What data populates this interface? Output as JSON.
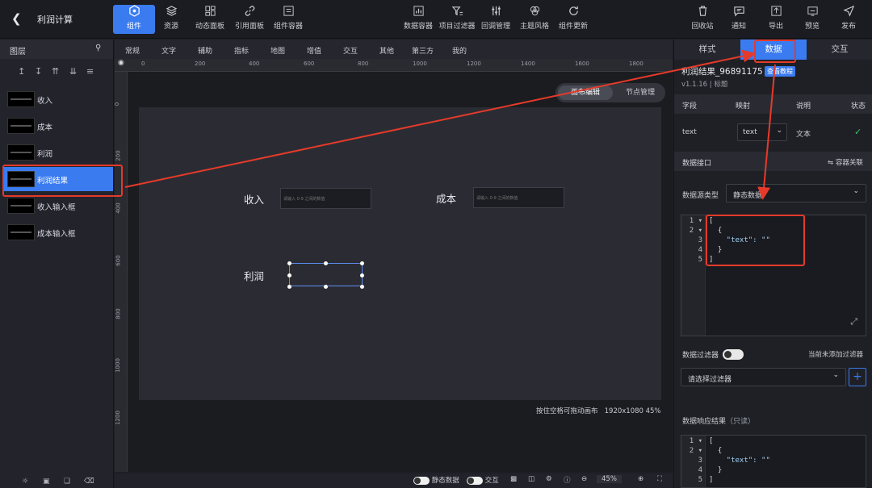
{
  "header": {
    "title": "利润计算",
    "left_tools": [
      "组件",
      "资源",
      "动态面板",
      "引用面板",
      "组件容器"
    ],
    "center_tools": [
      "数据容器",
      "项目过滤器",
      "回调管理",
      "主题风格",
      "组件更新"
    ],
    "right_tools": [
      "回收站",
      "通知",
      "导出",
      "预览",
      "发布"
    ]
  },
  "layers": {
    "title": "图层",
    "items": [
      {
        "name": "收入"
      },
      {
        "name": "成本"
      },
      {
        "name": "利润"
      },
      {
        "name": "利润结果"
      },
      {
        "name": "收入输入框"
      },
      {
        "name": "成本输入框"
      }
    ],
    "selected": "利润结果"
  },
  "component_tabs": [
    "常规",
    "文字",
    "辅助",
    "指标",
    "地图",
    "增值",
    "交互",
    "其他",
    "第三方",
    "我的"
  ],
  "ruler": {
    "h_ticks": [
      "0",
      "200",
      "400",
      "600",
      "800",
      "1000",
      "1200",
      "1400",
      "1600",
      "1800"
    ],
    "v_ticks": [
      "0",
      "200",
      "400",
      "600",
      "800",
      "1000",
      "1200"
    ]
  },
  "canvas": {
    "mode_toggle": {
      "active": "画布编辑",
      "inactive": "节点管理"
    },
    "labels": {
      "income": "收入",
      "cost": "成本",
      "profit": "利润"
    },
    "input_placeholder": "请输入 0-9 之间的数值",
    "hint": "按住空格可拖动画布",
    "size_zoom": "1920x1080 45%"
  },
  "bottom_bar": {
    "static_data": "静态数据",
    "interaction": "交互",
    "zoom": "45%"
  },
  "right_panel": {
    "tabs": [
      "样式",
      "数据",
      "交互"
    ],
    "active_tab": "数据",
    "component_title": "利润结果_96891175",
    "tutorial_button": "查看教程",
    "version": "v1.1.16 | 标题",
    "field_table": {
      "headers": [
        "字段",
        "映射",
        "说明",
        "状态"
      ],
      "rows": [
        {
          "field": "text",
          "mapping": "text",
          "desc": "文本",
          "status": "✓"
        }
      ]
    },
    "data_interface": {
      "title": "数据接口",
      "container_link": "⇋ 容器关联"
    },
    "source_type": {
      "label": "数据源类型",
      "value": "静态数据"
    },
    "code_lines": [
      "[",
      "  {",
      "    \"text\": \"\"",
      "  }",
      "]"
    ],
    "filter": {
      "label": "数据过滤器",
      "status": "当前未添加过滤器",
      "placeholder": "请选择过滤器"
    },
    "response": {
      "title": "数据响应结果",
      "readonly": "（只读）",
      "code_lines": [
        "[",
        "  {",
        "    \"text\": \"\"",
        "  }",
        "]"
      ]
    }
  },
  "colors": {
    "accent": "#3a7bf0",
    "annotation_red": "#e53a2a",
    "success": "#3cc46a"
  }
}
